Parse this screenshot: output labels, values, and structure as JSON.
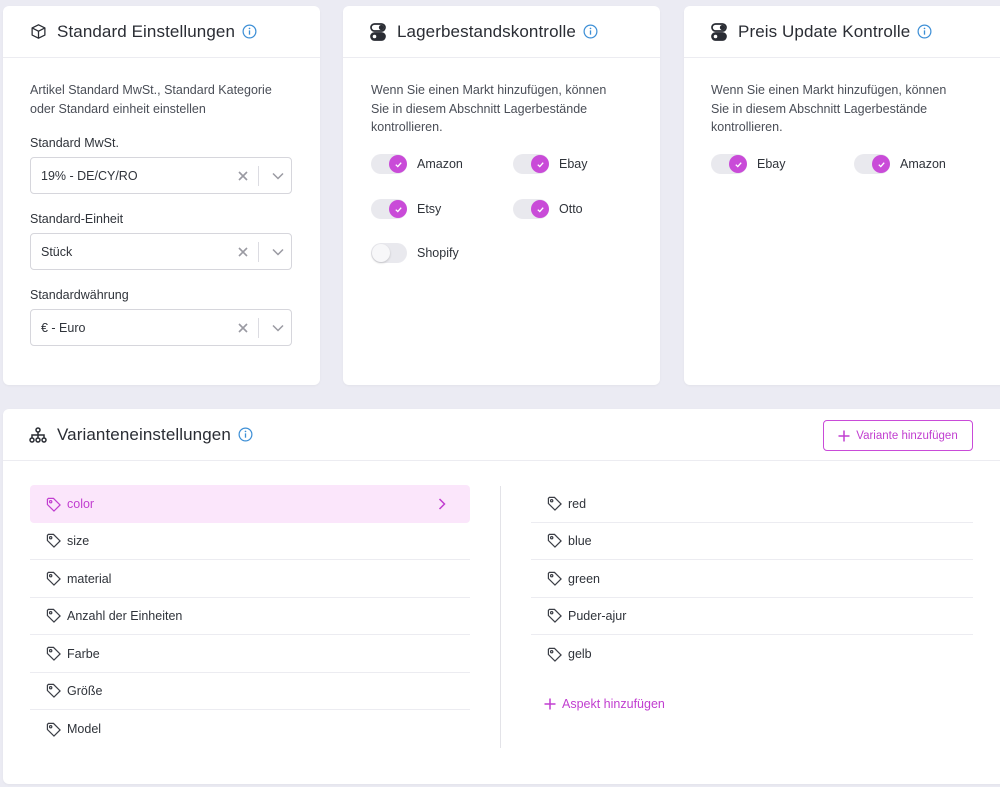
{
  "standard": {
    "title": "Standard Einstellungen",
    "description_line1": "Artikel Standard MwSt., Standard Kategorie",
    "description_line2": "oder Standard einheit einstellen",
    "fields": [
      {
        "label": "Standard MwSt.",
        "value": "19% - DE/CY/RO"
      },
      {
        "label": "Standard-Einheit",
        "value": "Stück"
      },
      {
        "label": "Standardwährung",
        "value": "€ - Euro"
      }
    ]
  },
  "stock": {
    "title": "Lagerbestandskontrolle",
    "description_line1": "Wenn Sie einen Markt hinzufügen, können",
    "description_line2": "Sie in diesem Abschnitt Lagerbestände",
    "description_line3": "kontrollieren.",
    "toggles": [
      {
        "label": "Amazon",
        "on": true
      },
      {
        "label": "Ebay",
        "on": true
      },
      {
        "label": "Etsy",
        "on": true
      },
      {
        "label": "Otto",
        "on": true
      },
      {
        "label": "Shopify",
        "on": false
      }
    ]
  },
  "price": {
    "title": "Preis Update Kontrolle",
    "description_line1": "Wenn Sie einen Markt hinzufügen, können",
    "description_line2": "Sie in diesem Abschnitt Lagerbestände",
    "description_line3": "kontrollieren.",
    "toggles": [
      {
        "label": "Ebay",
        "on": true
      },
      {
        "label": "Amazon",
        "on": true
      }
    ]
  },
  "variants": {
    "title": "Varianteneinstellungen",
    "add_button": "Variante hinzufügen",
    "attributes": [
      "color",
      "size",
      "material",
      "Anzahl der Einheiten",
      "Farbe",
      "Größe",
      "Model"
    ],
    "values": [
      "red",
      "blue",
      "green",
      "Puder-ajur",
      "gelb"
    ],
    "add_aspect": "Aspekt hinzufügen"
  },
  "colors": {
    "accent": "#c94bd8",
    "accent_text": "#c13ed0",
    "active_bg": "#fbe6fb",
    "info_blue": "#3d8fd6",
    "page_bg": "#ebebf3"
  },
  "icons": {
    "standard": "box-icon",
    "stock": "toggle-icon",
    "price": "toggle-icon",
    "variants": "hierarchy-icon",
    "info": "info-icon",
    "tag": "tag-icon",
    "clear": "close-icon",
    "chevron": "chevron-down-icon"
  }
}
